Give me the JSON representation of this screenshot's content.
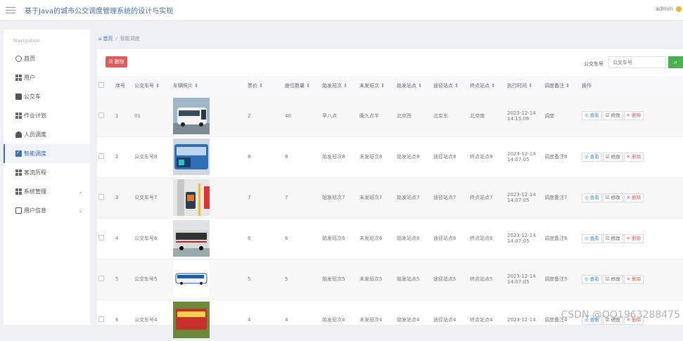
{
  "header": {
    "title": "基于Java的城市公交调度管理系统的设计与实现",
    "user": "admin"
  },
  "sidebar": {
    "title": "Navigation",
    "items": [
      {
        "label": "首页",
        "icon": "home-icon"
      },
      {
        "label": "用户",
        "icon": "grid-icon"
      },
      {
        "label": "公交车",
        "icon": "bus-icon"
      },
      {
        "label": "作业计划",
        "icon": "grid-icon"
      },
      {
        "label": "人员调度",
        "icon": "user-icon"
      },
      {
        "label": "智能调度",
        "icon": "check-icon",
        "active": true
      },
      {
        "label": "客流历程",
        "icon": "grid-icon"
      },
      {
        "label": "系统管理",
        "icon": "grid-icon",
        "expandable": true
      },
      {
        "label": "用户信息",
        "icon": "id-card-icon",
        "expandable": true
      }
    ]
  },
  "breadcrumb": {
    "home": "首页",
    "sep": "/",
    "current": "智能调度"
  },
  "toolbar": {
    "delete_label": "删除",
    "search_label": "公交车号",
    "search_placeholder": "公交车号",
    "search_icon": "search-icon"
  },
  "table": {
    "headers": [
      "序号",
      "公交车号 ⇕",
      "车辆照片 ⇕",
      "票价 ⇕",
      "座位数量 ⇕",
      "始发班次 ⇕",
      "末发班次 ⇕",
      "始发站点 ⇕",
      "途径站点 ⇕",
      "终点站点 ⇕",
      "执行时间 ⇕",
      "调度备注 ⇕",
      "操作"
    ],
    "rows": [
      {
        "no": "1",
        "bus": "01",
        "fare": "2",
        "seats": "40",
        "first": "早八点",
        "last": "晚九点半",
        "start": "北京西",
        "via": "北京东",
        "end": "北京南",
        "time": "2023-12-14 14:15:06",
        "note": "调度",
        "photo": "white-bus"
      },
      {
        "no": "2",
        "bus": "公交车号8",
        "fare": "8",
        "seats": "8",
        "first": "始发班次8",
        "last": "末发班次8",
        "start": "始发站点8",
        "via": "途径站点8",
        "end": "终点站点8",
        "time": "2023-12-14 14:07:05",
        "note": "调度备注8",
        "photo": "blue-bus"
      },
      {
        "no": "3",
        "bus": "公交车号7",
        "fare": "7",
        "seats": "7",
        "first": "始发班次7",
        "last": "末发班次7",
        "start": "始发站点7",
        "via": "途径站点7",
        "end": "终点站点7",
        "time": "2023-12-14 14:07:05",
        "note": "调度备注7",
        "photo": "bus-interior"
      },
      {
        "no": "4",
        "bus": "公交车号6",
        "fare": "6",
        "seats": "6",
        "first": "始发班次6",
        "last": "末发班次6",
        "start": "始发站点6",
        "via": "途径站点6",
        "end": "终点站点6",
        "time": "2023-12-14 14:07:05",
        "note": "调度备注6",
        "photo": "grey-bus"
      },
      {
        "no": "5",
        "bus": "公交车号5",
        "fare": "5",
        "seats": "5",
        "first": "始发班次5",
        "last": "末发班次5",
        "start": "始发站点5",
        "via": "途径站点5",
        "end": "终点站点5",
        "time": "2023-12-14 14:07:05",
        "note": "调度备注5",
        "photo": "small-bus"
      },
      {
        "no": "6",
        "bus": "公交车号4",
        "fare": "4",
        "seats": "4",
        "first": "始发班次4",
        "last": "末发班次4",
        "start": "始发站点4",
        "via": "途径站点4",
        "end": "终点站点4",
        "time": "2023-12-14",
        "note": "调度备注4",
        "photo": "red-bus"
      }
    ],
    "actions": {
      "view": "查看",
      "edit": "修改",
      "delete": "删除"
    }
  },
  "watermark": "CSDN @QQ1963288475",
  "colors": {
    "accent": "#3d6fb8",
    "danger": "#e05a5a",
    "success": "#4caf50"
  }
}
